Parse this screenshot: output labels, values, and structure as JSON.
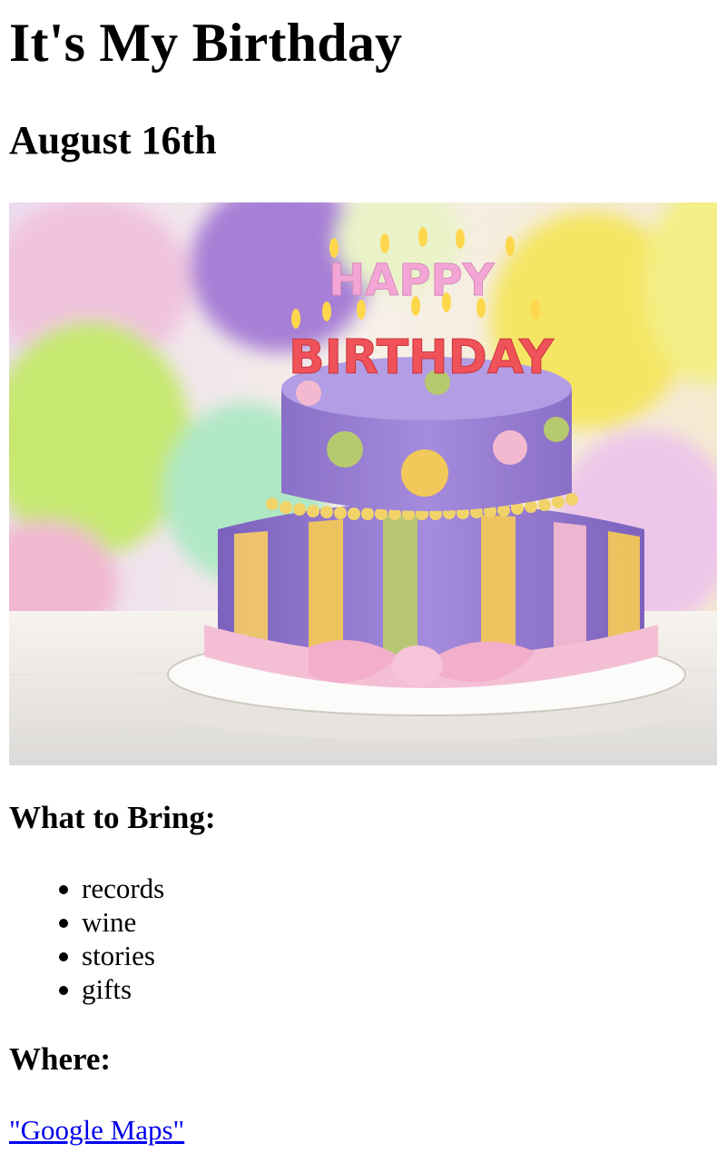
{
  "page": {
    "title": "It's My Birthday",
    "date": "August 16th"
  },
  "hero_image": {
    "icon": "birthday-cake-image",
    "candle_top_text": "HAPPY",
    "candle_bottom_text": "BIRTHDAY"
  },
  "bring": {
    "heading": "What to Bring:",
    "items": [
      "records",
      "wine",
      "stories",
      "gifts"
    ]
  },
  "where": {
    "heading": "Where:",
    "link_text": "\"Google Maps\""
  },
  "colors": {
    "link": "#0000ee",
    "cake_purple": "#9b83d3",
    "frosting_pink": "#f3b9d0",
    "stripe_yellow": "#f2c85a",
    "stripe_green": "#b7c96e"
  }
}
